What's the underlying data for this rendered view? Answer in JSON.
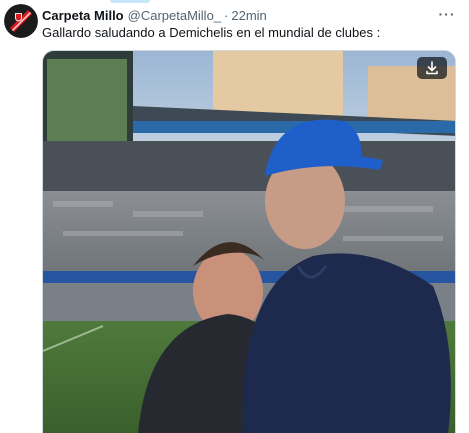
{
  "post": {
    "author_name": "Carpeta Millo",
    "author_handle": "@CarpetaMillo_",
    "separator": "·",
    "time": "22min",
    "more_label": "···",
    "text": "Gallardo saludando a Demichelis en el mundial de clubes :"
  },
  "icons": {
    "avatar": "river-plate-crest-avatar",
    "more": "more-options-icon",
    "download": "download-icon"
  },
  "colors": {
    "text_primary": "#0f1419",
    "text_secondary": "#536471",
    "border": "#cfd9de"
  }
}
